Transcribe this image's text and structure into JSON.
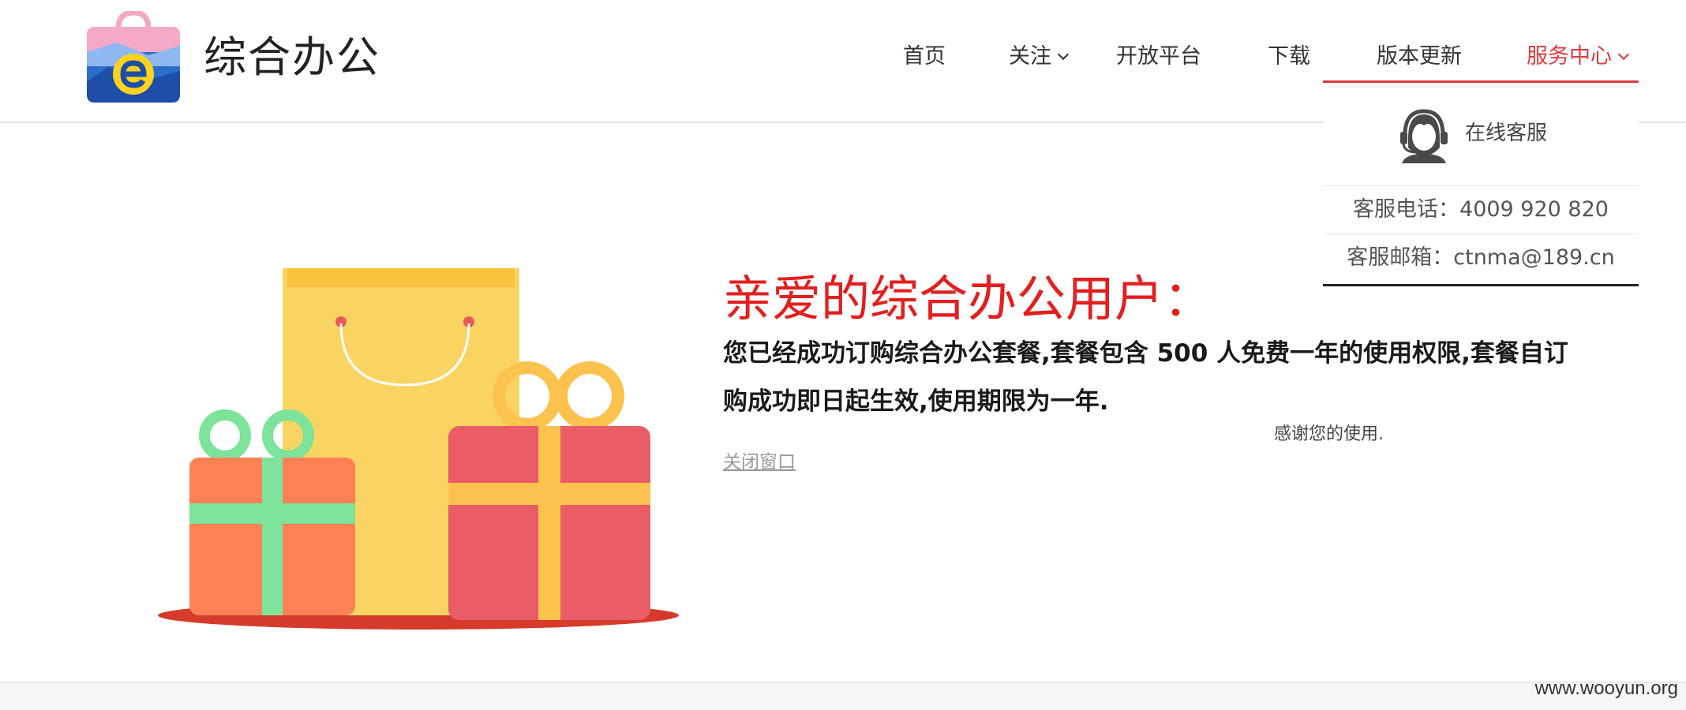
{
  "header": {
    "brand": "综合办公",
    "nav": [
      {
        "label": "首页"
      },
      {
        "label": "关注"
      },
      {
        "label": "开放平台"
      },
      {
        "label": "下载"
      },
      {
        "label": "版本更新"
      },
      {
        "label": "服务中心"
      }
    ]
  },
  "service_menu": {
    "online": "在线客服",
    "phone": "客服电话：4009 920 820",
    "email": "客服邮箱：ctnma@189.cn"
  },
  "content": {
    "heading": "亲爱的综合办公用户：",
    "message": "您已经成功订购综合办公套餐,套餐包含 500 人免费一年的使用权限,套餐自订购成功即日起生效,使用期限为一年.",
    "thanks": "感谢您的使用.",
    "close": "关闭窗口"
  },
  "watermark": "www.wooyun.org",
  "colors": {
    "accent": "#e0383c",
    "heading": "#e41e1e"
  }
}
